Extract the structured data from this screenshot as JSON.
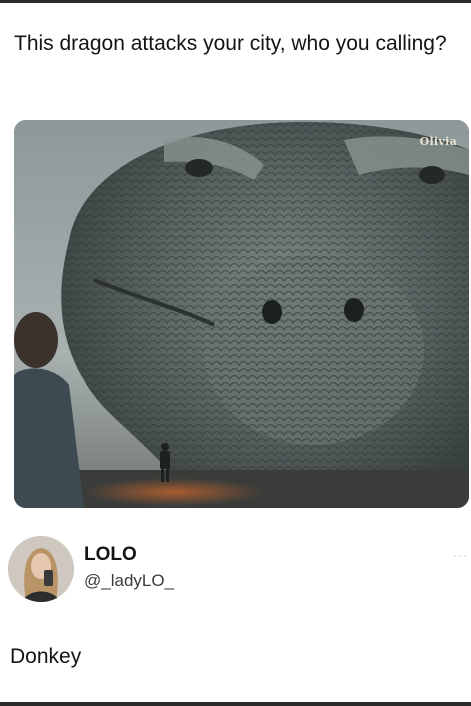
{
  "post": {
    "text": "This dragon attacks your city, who you calling?",
    "image": {
      "description_icon": "dragon-photo",
      "watermark": "Olivia"
    }
  },
  "reply": {
    "display_name": "LOLO",
    "handle": "@_ladyLO_",
    "more_icon": "···",
    "text": "Donkey"
  },
  "colors": {
    "background": "#ffffff",
    "text": "#141414",
    "border": "#2a2a2a"
  }
}
